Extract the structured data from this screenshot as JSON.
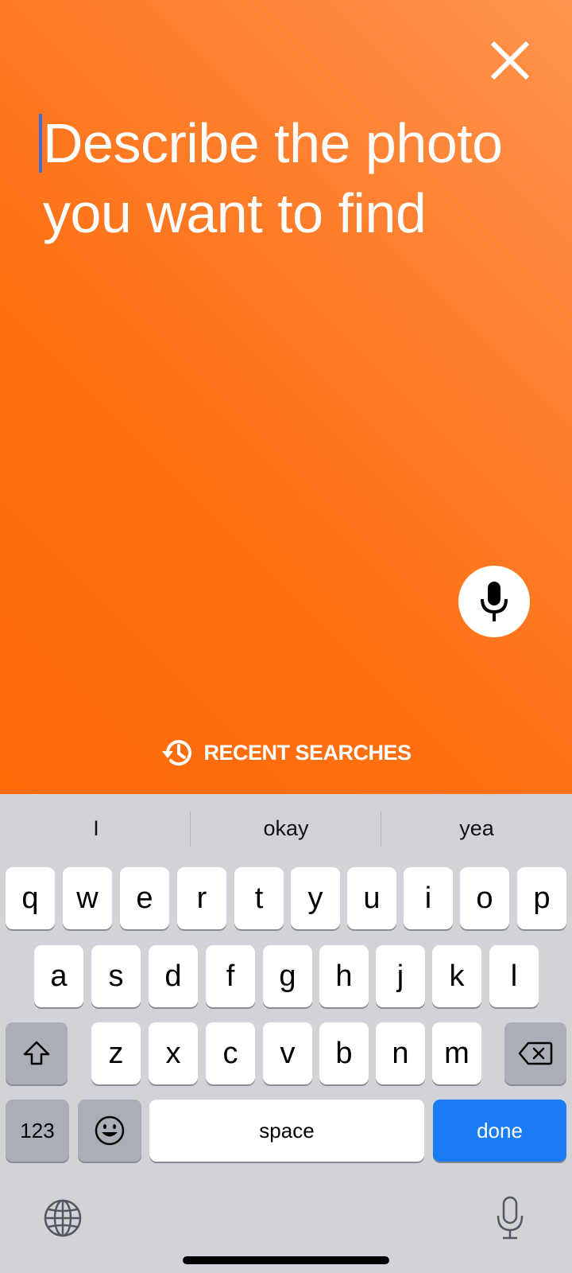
{
  "search": {
    "placeholder": "Describe the photo you want to find",
    "recent_label": "RECENT SEARCHES"
  },
  "icons": {
    "close": "close-icon",
    "mic": "microphone-icon",
    "history": "history-icon",
    "shift": "shift-icon",
    "delete": "delete-icon",
    "emoji": "emoji-icon",
    "globe": "globe-icon",
    "dictation": "dictation-icon"
  },
  "colors": {
    "accent_top": "#ff9550",
    "accent_bottom": "#ff690a",
    "done_key": "#1a7cf5",
    "caret": "#3b6fe0"
  },
  "keyboard": {
    "suggestions": [
      "I",
      "okay",
      "yea"
    ],
    "row1": [
      "q",
      "w",
      "e",
      "r",
      "t",
      "y",
      "u",
      "i",
      "o",
      "p"
    ],
    "row2": [
      "a",
      "s",
      "d",
      "f",
      "g",
      "h",
      "j",
      "k",
      "l"
    ],
    "row3": [
      "z",
      "x",
      "c",
      "v",
      "b",
      "n",
      "m"
    ],
    "numbers_label": "123",
    "space_label": "space",
    "done_label": "done"
  }
}
